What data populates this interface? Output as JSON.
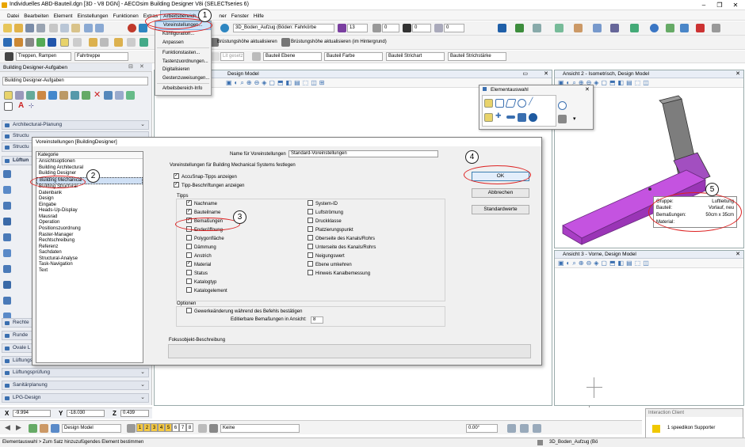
{
  "app": {
    "title": "Individuelles ABD-Bauteil.dgn [3D - V8 DGN] - AECOsim Building Designer V8i (SELECTseries 6)"
  },
  "menubar": [
    "Datei",
    "Bearbeiten",
    "Element",
    "Einstellungen",
    "Funktionen",
    "Extras",
    "Arbeitsbereich",
    "Ge",
    "Fenster",
    "Hilfe"
  ],
  "menubar_tail": "ner",
  "arbeitsbereich_menu": [
    "Voreinstellungen...",
    "Konfiguration...",
    "Anpassen",
    "Funktionstasten...",
    "Tastenzuordnungen...",
    "Digitalisieren",
    "Gestenzuweisungen...",
    "Arbeitsbereich-Info"
  ],
  "toolbar": {
    "level": "3D_Boden_Aufzug (Böden: Fahrkörbe",
    "color_num": "13",
    "weight_num": "0",
    "linestyle_num": "0",
    "transp_num": "0",
    "bruestung1": "Brüstungshöhe aktualisieren",
    "bruestung2": "Brüstungshöhe aktualisieren (im Hintergrund)",
    "treppen": "Treppen, Rampen",
    "fahrtreppe": "Fahrtreppe",
    "gesetzt": "Lit gesetzt",
    "bauteil_ebene": "Bauteil Ebene",
    "bauteil_farbe": "Bauteil Farbe",
    "bauteil_strichart": "Bauteil Strichart",
    "bauteil_strichstaerke": "Bauteil Strichstärke"
  },
  "left_panel": {
    "title": "Building Designer-Aufgaben",
    "dropdown": "Building Designer-Aufgaben",
    "sections_top": [
      "Architectural-Planung",
      "Structu",
      "Structu",
      "Lüftun"
    ],
    "sections_bottom": [
      "Rechte",
      "Runde",
      "Ovale L",
      "Lüftungs",
      "Lüftungsprüfung",
      "Sanitärplanung",
      "LPG-Design"
    ]
  },
  "views": {
    "view1_title": "Design Model",
    "view2_title": "Ansicht 2 - Isometrisch, Design Model",
    "view3_title": "Ansicht 3 - Vorne, Design Model"
  },
  "elementauswahl": {
    "title": "Elementauswahl"
  },
  "dialog": {
    "title": "Voreinstellungen [BuildingDesigner]",
    "kategorie_header": "Kategorie",
    "categories": [
      "Ansichtsoptionen",
      "Building Architectural",
      "Building Designer",
      "Building Mechanical",
      "Building Structural",
      "Datenbank",
      "Design",
      "Eingabe",
      "Heads-Up-Display",
      "Mausrad",
      "Operation",
      "Positionszuordnung",
      "Raster-Manager",
      "Rechtschreibung",
      "Referenz",
      "Sachdaten",
      "Structural-Analyse",
      "Task-Navigation",
      "Text"
    ],
    "selected_index": 3,
    "name_label": "Name für Voreinstellungen",
    "name_value": "Standard-Voreinstellungen",
    "heading": "Voreinstellungen für Building Mechanical Systems festlegen",
    "opt_accusnap": "AccuSnap-Tipps anzeigen",
    "opt_tipp": "Tipp-Beschriftungen anzeigen",
    "tipps_label": "Tipps",
    "tipps_left": [
      {
        "label": "Nachname",
        "checked": true
      },
      {
        "label": "Bauteilname",
        "checked": true
      },
      {
        "label": "Bemaßungen",
        "checked": true
      },
      {
        "label": "Enderöffnung",
        "checked": false
      },
      {
        "label": "Polygonfläche",
        "checked": false
      },
      {
        "label": "Dämmung",
        "checked": false
      },
      {
        "label": "Anstrich",
        "checked": false
      },
      {
        "label": "Material",
        "checked": true
      },
      {
        "label": "Status",
        "checked": false
      },
      {
        "label": "Katalogtyp",
        "checked": false
      },
      {
        "label": "Katalogelement",
        "checked": false
      }
    ],
    "tipps_right": [
      {
        "label": "System-ID",
        "checked": false
      },
      {
        "label": "Luftströmung",
        "checked": false
      },
      {
        "label": "Druckklasse",
        "checked": false
      },
      {
        "label": "Platzierungspunkt",
        "checked": false
      },
      {
        "label": "Oberseite des Kanals/Rohrs",
        "checked": false
      },
      {
        "label": "Unterseite des Kanals/Rohrs",
        "checked": false
      },
      {
        "label": "Neigungswert",
        "checked": false
      },
      {
        "label": "Ebene umkehren",
        "checked": false
      },
      {
        "label": "Hinweis Kanalbemessung",
        "checked": false
      }
    ],
    "optionen_label": "Optionen",
    "opt_gewerk": "Gewerkeänderung während des Befehls bestätigen",
    "editierbare_label": "Editierbare Bemaßungen in Ansicht:",
    "editierbare_value": "8",
    "fokus_label": "Fokusobjekt-Beschreibung",
    "ok": "OK",
    "abbrechen": "Abbrechen",
    "standardwerte": "Standardwerte"
  },
  "tooltip": {
    "rows": [
      [
        "Gruppe:",
        "Luftleitung"
      ],
      [
        "Bauteil:",
        "Vorlauf, neu"
      ],
      [
        "Bemaßungen:",
        "50cm x 35cm"
      ],
      [
        "Material:",
        ""
      ]
    ]
  },
  "annotations": [
    "1",
    "2",
    "3",
    "4",
    "5"
  ],
  "coords": {
    "x_label": "X",
    "x_value": "-9.994",
    "y_label": "Y",
    "y_value": "-18.030",
    "z_label": "Z",
    "z_value": "0.439"
  },
  "statusbar": {
    "model": "Design Model",
    "view_numbers": [
      "1",
      "2",
      "3",
      "4",
      "5",
      "6",
      "7",
      "8"
    ],
    "keine": "Keine",
    "angle": "0.00°",
    "bottom_left": "Elementauswahl > Zum Satz hinzuzufügendes Element bestimmen",
    "bottom_right": "3D_Boden_Aufzug (Bö"
  },
  "interaction": {
    "title": "Interaction Client",
    "text": "1 speedikon Supporter"
  },
  "colors": {
    "accent": "#3a6fb0",
    "duct": "#b23fd0",
    "annot": "#dd2222"
  }
}
